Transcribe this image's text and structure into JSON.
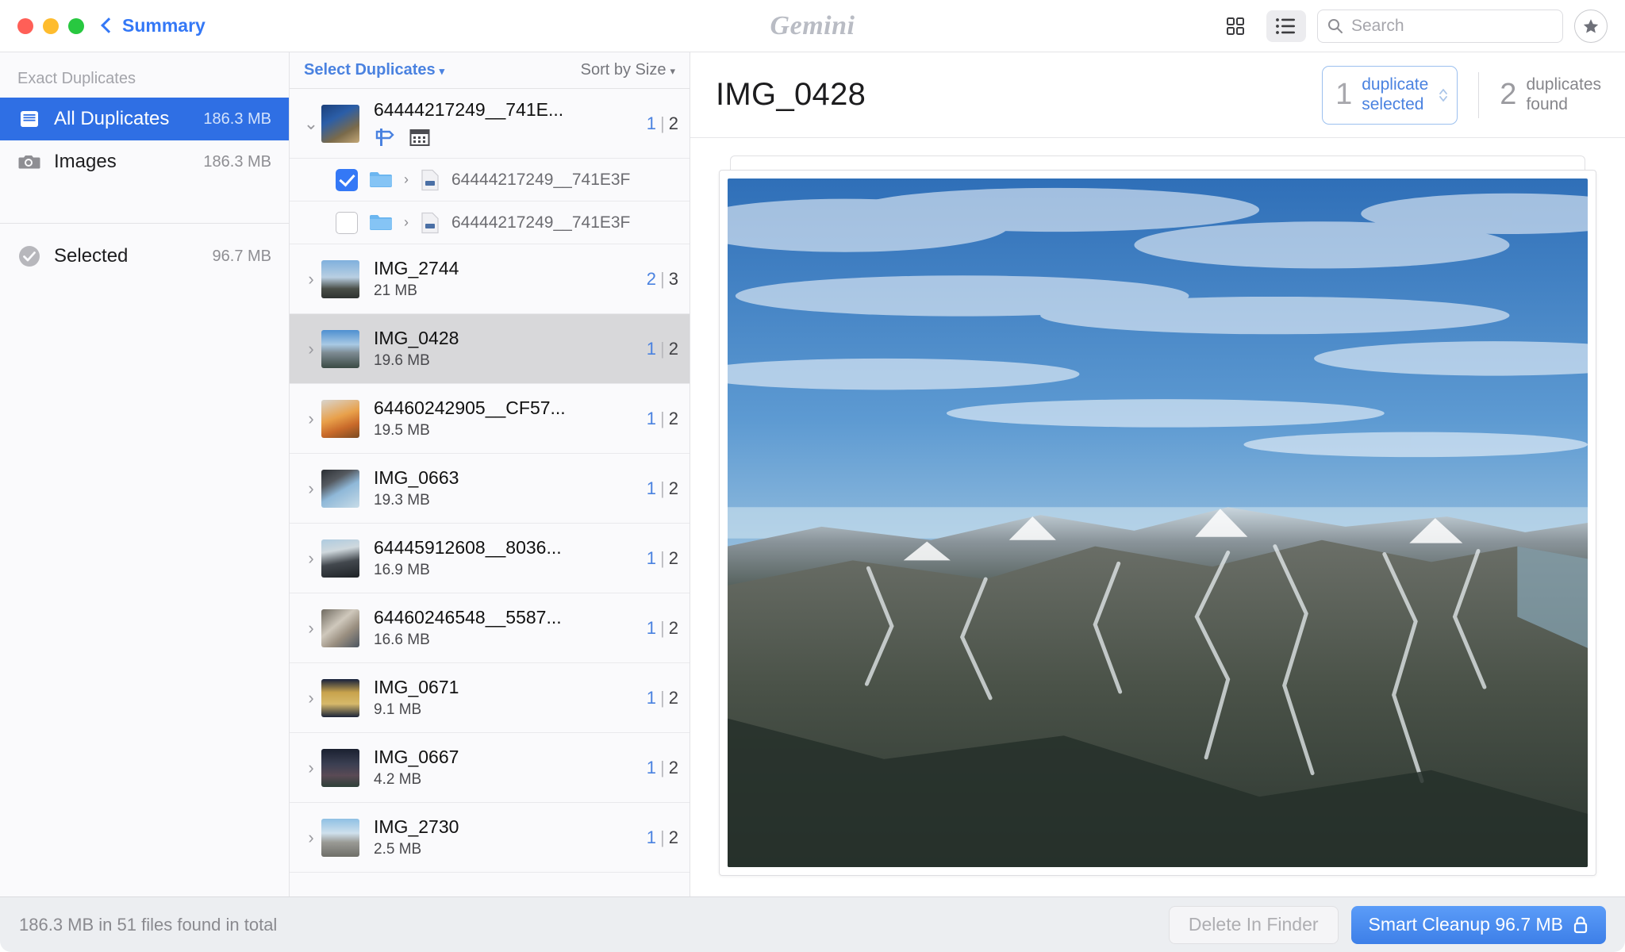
{
  "titlebar": {
    "back_label": "Summary",
    "app_logo": "Gemini",
    "grid_view_icon": "grid-view-icon",
    "list_view_icon": "list-view-icon",
    "search_placeholder": "Search",
    "search_value": "",
    "star_icon": "star-icon",
    "accent": "#3478f6"
  },
  "sidebar": {
    "section_header": "Exact Duplicates",
    "items": [
      {
        "label": "All Duplicates",
        "size": "186.3 MB",
        "icon": "duplicates-tray-icon",
        "selected": true
      },
      {
        "label": "Images",
        "size": "186.3 MB",
        "icon": "camera-icon",
        "selected": false
      }
    ],
    "selected_row": {
      "label": "Selected",
      "size": "96.7 MB",
      "icon": "check-circle-icon"
    },
    "selected_bg": "#2f6fe4"
  },
  "list": {
    "select_label": "Select Duplicates",
    "sort_label": "Sort by Size",
    "caret": "▾",
    "groups": [
      {
        "name": "64444217249__741E...",
        "size": "",
        "selected_count": "1",
        "total_count": "2",
        "expanded": true,
        "badges": [
          "signpost-icon",
          "calendar-icon"
        ],
        "thumb": "blue-rock-thumb",
        "children": [
          {
            "name": "64444217249__741E3F",
            "checked": true
          },
          {
            "name": "64444217249__741E3F",
            "checked": false
          }
        ]
      },
      {
        "name": "IMG_2744",
        "size": "21 MB",
        "selected_count": "2",
        "total_count": "3",
        "expanded": false,
        "thumb": "city-aerial-thumb",
        "children": []
      },
      {
        "name": "IMG_0428",
        "size": "19.6 MB",
        "selected_count": "1",
        "total_count": "2",
        "expanded": false,
        "highlighted": true,
        "thumb": "mountain-thumb",
        "children": []
      },
      {
        "name": "64460242905__CF57...",
        "size": "19.5 MB",
        "selected_count": "1",
        "total_count": "2",
        "expanded": false,
        "thumb": "food-thumb",
        "children": []
      },
      {
        "name": "IMG_0663",
        "size": "19.3 MB",
        "selected_count": "1",
        "total_count": "2",
        "expanded": false,
        "thumb": "ticket-thumb",
        "children": []
      },
      {
        "name": "64445912608__8036...",
        "size": "16.9 MB",
        "selected_count": "1",
        "total_count": "2",
        "expanded": false,
        "thumb": "car-thumb",
        "children": []
      },
      {
        "name": "64460246548__5587...",
        "size": "16.6 MB",
        "selected_count": "1",
        "total_count": "2",
        "expanded": false,
        "thumb": "sign-thumb",
        "children": []
      },
      {
        "name": "IMG_0671",
        "size": "9.1 MB",
        "selected_count": "1",
        "total_count": "2",
        "expanded": false,
        "thumb": "poster-thumb",
        "children": []
      },
      {
        "name": "IMG_0667",
        "size": "4.2 MB",
        "selected_count": "1",
        "total_count": "2",
        "expanded": false,
        "thumb": "dark-thumb",
        "children": []
      },
      {
        "name": "IMG_2730",
        "size": "2.5 MB",
        "selected_count": "1",
        "total_count": "2",
        "expanded": false,
        "thumb": "valley-thumb",
        "children": []
      }
    ]
  },
  "detail": {
    "title": "IMG_0428",
    "selected_number": "1",
    "selected_line1": "duplicate",
    "selected_line2": "selected",
    "found_number": "2",
    "found_line1": "duplicates",
    "found_line2": "found",
    "stepper_border": "#9cc0ef",
    "preview_alt": "aerial photo of snow-covered mountain range under blue sky"
  },
  "statusbar": {
    "summary": "186.3 MB in 51 files found in total",
    "delete_label": "Delete In Finder",
    "cleanup_label": "Smart Cleanup 96.7 MB",
    "lock_icon": "lock-icon",
    "primary_color": "#3d7fe8"
  }
}
